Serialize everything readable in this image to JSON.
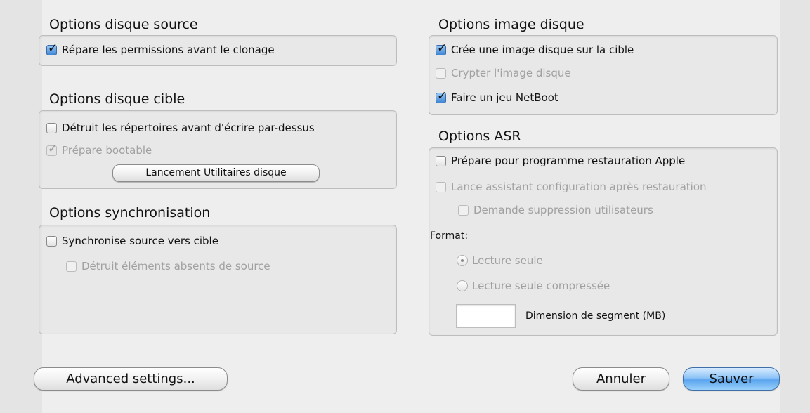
{
  "source_options": {
    "title": "Options disque source",
    "repair_permissions": {
      "label": "Répare les permissions avant le clonage",
      "checked": true
    }
  },
  "target_options": {
    "title": "Options disque cible",
    "erase_dirs": {
      "label": "Détruit les répertoires avant d'écrire par-dessus",
      "checked": false
    },
    "prepare_bootable": {
      "label": "Prépare bootable",
      "checked": true,
      "disabled": true
    },
    "launch_disk_utility": "Lancement Utilitaires disque"
  },
  "sync_options": {
    "title": "Options synchronisation",
    "sync_source_to_target": {
      "label": "Synchronise source vers cible",
      "checked": false
    },
    "delete_absent": {
      "label": "Détruit éléments absents de source",
      "checked": false,
      "disabled": true
    }
  },
  "image_options": {
    "title": "Options image disque",
    "create_image": {
      "label": "Crée une image disque sur la cible",
      "checked": true
    },
    "encrypt_image": {
      "label": "Crypter l'image disque",
      "checked": false,
      "disabled": true
    },
    "netboot_set": {
      "label": "Faire un jeu NetBoot",
      "checked": true
    }
  },
  "asr_options": {
    "title": "Options ASR",
    "prepare_apple_restore": {
      "label": "Prépare pour programme restauration Apple",
      "checked": false
    },
    "launch_setup_assistant": {
      "label": "Lance assistant configuration après restauration",
      "checked": false,
      "disabled": true
    },
    "ask_delete_users": {
      "label": "Demande suppression utilisateurs",
      "checked": false,
      "disabled": true
    },
    "format_label": "Format:",
    "format_read_only": {
      "label": "Lecture seule",
      "selected": true
    },
    "format_read_only_compressed": {
      "label": "Lecture seule compressée",
      "selected": false
    },
    "segment_size_value": "",
    "segment_size_label": "Dimension de segment (MB)"
  },
  "buttons": {
    "advanced": "Advanced settings...",
    "cancel": "Annuler",
    "save": "Sauver"
  }
}
